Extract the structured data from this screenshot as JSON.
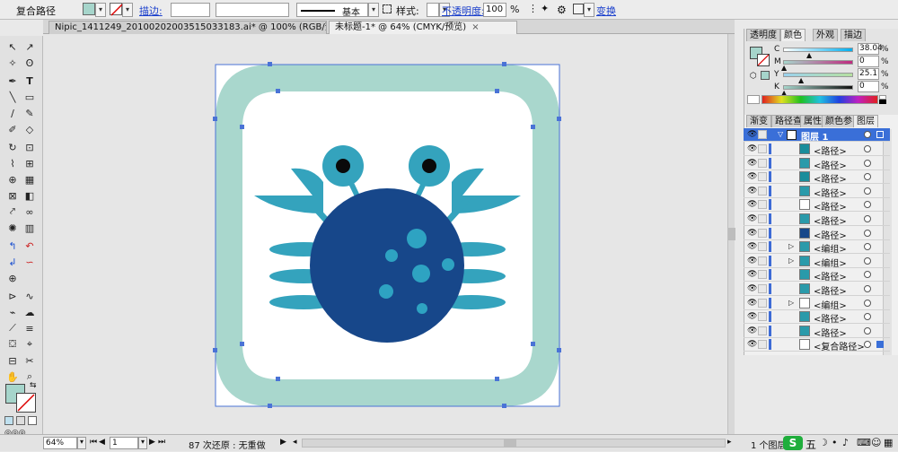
{
  "control_bar": {
    "selection_type": "复合路径",
    "stroke_label": "描边:",
    "stroke_weight": "",
    "stroke_profile": "基本",
    "style_label": "样式:",
    "opacity_label": "不透明度:",
    "opacity_value": "100",
    "opacity_unit": "%",
    "transform_label": "变换",
    "fill_color": "#a6d5cb"
  },
  "tabs": [
    {
      "label": "Nipic_1411249_20100202003515033183.ai* @ 100% (RGB/预览)",
      "close": "×"
    },
    {
      "label": "未标题-1* @ 64% (CMYK/预览)",
      "close": "×"
    }
  ],
  "color_panel": {
    "tabs": [
      "透明度",
      "颜色",
      "外观",
      "描边"
    ],
    "channels": [
      {
        "name": "C",
        "value": "38.04"
      },
      {
        "name": "M",
        "value": "0"
      },
      {
        "name": "Y",
        "value": "25.1"
      },
      {
        "name": "K",
        "value": "0"
      }
    ]
  },
  "layers_panel": {
    "tabs": [
      "渐变",
      "路径查",
      "属性",
      "颜色参",
      "图层"
    ],
    "root_layer": "图层 1",
    "items": [
      {
        "name": "<路径>",
        "thumb": "#1a8d9b"
      },
      {
        "name": "<路径>",
        "thumb": "#2a9aaa"
      },
      {
        "name": "<路径>",
        "thumb": "#1a8d9b"
      },
      {
        "name": "<路径>",
        "thumb": "#2a9aaa"
      },
      {
        "name": "<路径>",
        "thumb": "#ffffff"
      },
      {
        "name": "<路径>",
        "thumb": "#2a9aaa"
      },
      {
        "name": "<路径>",
        "thumb": "#16478a"
      },
      {
        "name": "<编组>",
        "thumb": "#2a9aaa",
        "expand": "▷"
      },
      {
        "name": "<编组>",
        "thumb": "#2a9aaa",
        "expand": "▷"
      },
      {
        "name": "<路径>",
        "thumb": "#2a9aaa"
      },
      {
        "name": "<路径>",
        "thumb": "#2a9aaa"
      },
      {
        "name": "<编组>",
        "thumb": "#ffffff",
        "expand": "▷"
      },
      {
        "name": "<路径>",
        "thumb": "#2a9aaa"
      },
      {
        "name": "<路径>",
        "thumb": "#2a9aaa"
      },
      {
        "name": "<复合路径>",
        "thumb": "#ffffff"
      }
    ]
  },
  "status_bar": {
    "zoom": "64%",
    "page": "1",
    "undo_info": "87 次还原 : 无重做",
    "layers_count": "1 个图层"
  },
  "artwork": {
    "frame_color": "#a9d7cd",
    "body_color": "#17478a",
    "claw_color": "#34a3bd",
    "eye_ring_color": "#34a3bd",
    "pupil_color": "#0a0a0a",
    "spot_color": "#2ea3c2"
  },
  "ime": {
    "logo": "S",
    "mode": "五"
  }
}
